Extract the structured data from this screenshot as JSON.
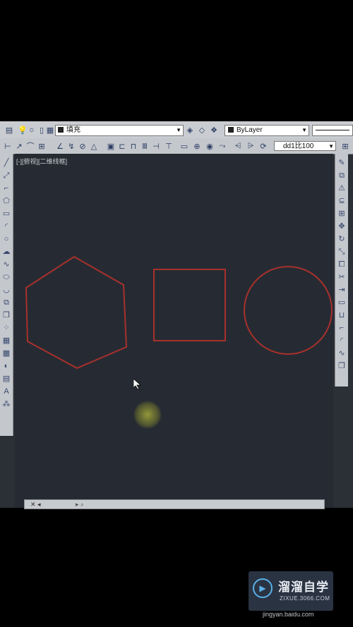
{
  "toolbar": {
    "layer_name": "填充",
    "color_value": "ByLayer",
    "dim_style": "dd1比100"
  },
  "viewport": {
    "label": "[-][俯视][二维线框]"
  },
  "watermark": {
    "name": "溜溜自学",
    "sub": "ZIXUE.3066.COM"
  },
  "footer": {
    "site": "jingyan.baidu.com"
  },
  "colors": {
    "shape_stroke": "#a8302c",
    "canvas": "#262b33"
  }
}
